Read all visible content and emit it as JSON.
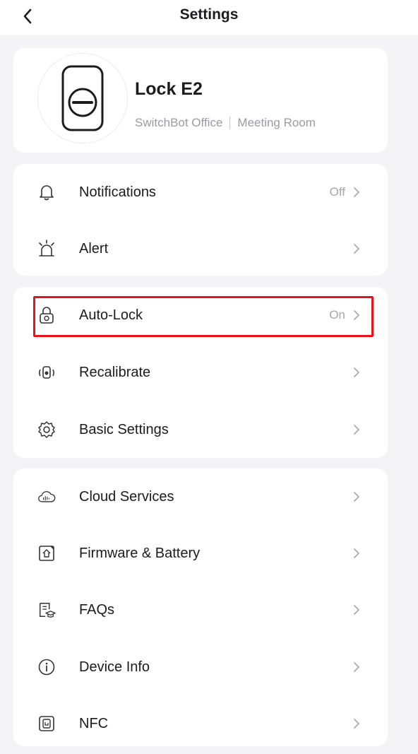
{
  "header": {
    "title": "Settings",
    "back_icon": "back-chevron-icon"
  },
  "device": {
    "name": "Lock E2",
    "location_home": "SwitchBot Office",
    "location_room": "Meeting Room",
    "icon": "lock-device-icon"
  },
  "groups": [
    {
      "items": [
        {
          "label": "Notifications",
          "value": "Off",
          "icon": "bell-icon"
        },
        {
          "label": "Alert",
          "value": "",
          "icon": "alarm-icon"
        }
      ]
    },
    {
      "items": [
        {
          "label": "Auto-Lock",
          "value": "On",
          "icon": "padlock-icon",
          "highlighted": true
        },
        {
          "label": "Recalibrate",
          "value": "",
          "icon": "recalibrate-icon"
        },
        {
          "label": "Basic Settings",
          "value": "",
          "icon": "gear-icon"
        }
      ]
    },
    {
      "items": [
        {
          "label": "Cloud Services",
          "value": "",
          "icon": "cloud-icon"
        },
        {
          "label": "Firmware & Battery",
          "value": "",
          "icon": "firmware-icon"
        },
        {
          "label": "FAQs",
          "value": "",
          "icon": "faq-icon"
        },
        {
          "label": "Device Info",
          "value": "",
          "icon": "info-icon"
        },
        {
          "label": "NFC",
          "value": "",
          "icon": "nfc-icon"
        }
      ]
    }
  ],
  "colors": {
    "highlight_border": "#e3141c",
    "background": "#f4f4f6",
    "card": "#ffffff"
  }
}
